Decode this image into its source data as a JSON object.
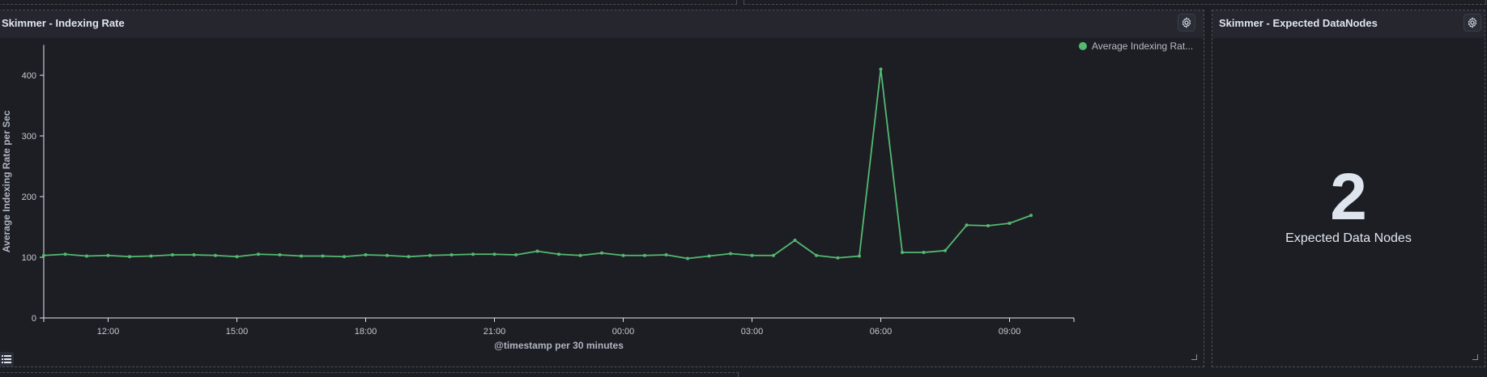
{
  "panels": {
    "indexing": {
      "title": "Skimmer - Indexing Rate"
    },
    "datanodes": {
      "title": "Skimmer - Expected DataNodes",
      "value": "2",
      "label": "Expected Data Nodes"
    }
  },
  "colors": {
    "background": "#1d1e24",
    "series": "#54b970",
    "axis": "#dfe5ef",
    "text": "#dfe5ef"
  },
  "icons": {
    "settings": "gear-icon",
    "legend_toggle": "list-icon",
    "resize": "resize-handle-icon"
  },
  "chart_data": {
    "type": "line",
    "title": "",
    "xlabel": "@timestamp per 30 minutes",
    "ylabel": "Average Indexing Rate per Sec",
    "ylim": [
      0,
      450
    ],
    "y_ticks": [
      0,
      100,
      200,
      300,
      400
    ],
    "x_tick_labels": [
      "12:00",
      "15:00",
      "18:00",
      "21:00",
      "00:00",
      "03:00",
      "06:00",
      "09:00"
    ],
    "x_tick_index": [
      3,
      9,
      15,
      21,
      27,
      33,
      39,
      45
    ],
    "x_total_slots": 48,
    "legend_position": "top-right",
    "grid": false,
    "series": [
      {
        "name": "Average Indexing Rat...",
        "values": [
          103,
          105,
          102,
          103,
          101,
          102,
          104,
          104,
          103,
          101,
          105,
          104,
          102,
          102,
          101,
          104,
          103,
          101,
          103,
          104,
          105,
          105,
          104,
          110,
          105,
          103,
          107,
          103,
          103,
          104,
          98,
          102,
          106,
          103,
          103,
          128,
          103,
          99,
          102,
          410,
          108,
          108,
          111,
          153,
          152,
          156,
          169
        ]
      }
    ]
  }
}
